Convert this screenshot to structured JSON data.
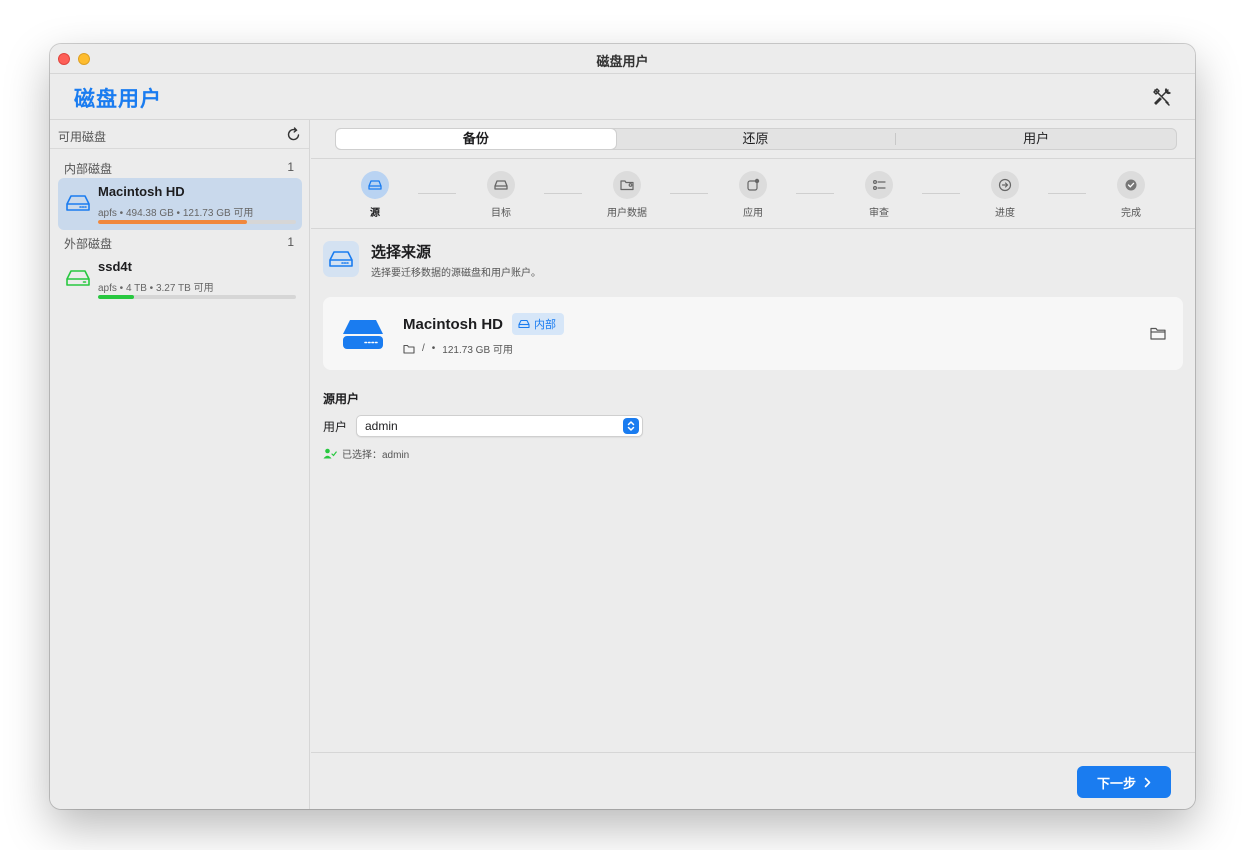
{
  "window": {
    "title": "磁盘用户"
  },
  "header": {
    "app_title": "磁盘用户",
    "tools_icon": "wrench-screwdriver-icon"
  },
  "sidebar": {
    "heading": "可用磁盘",
    "refresh_icon": "refresh-icon",
    "groups": [
      {
        "label": "内部磁盘",
        "count": "1",
        "disks": [
          {
            "name": "Macintosh HD",
            "meta": "apfs • 494.38 GB • 121.73 GB 可用",
            "usage": 0.75,
            "bar_color": "#f0883e",
            "icon_color": "#1a7cf0",
            "selected": true
          }
        ]
      },
      {
        "label": "外部磁盘",
        "count": "1",
        "disks": [
          {
            "name": "ssd4t",
            "meta": "apfs • 4 TB • 3.27 TB 可用",
            "usage": 0.18,
            "bar_color": "#28c840",
            "icon_color": "#28c840",
            "selected": false
          }
        ]
      }
    ]
  },
  "tabs": [
    {
      "label": "备份",
      "active": true
    },
    {
      "label": "还原",
      "active": false
    },
    {
      "label": "用户",
      "active": false
    }
  ],
  "steps": [
    {
      "label": "源",
      "icon": "drive-icon",
      "active": true
    },
    {
      "label": "目标",
      "icon": "drive-icon",
      "active": false
    },
    {
      "label": "用户数据",
      "icon": "folder-person-icon",
      "active": false
    },
    {
      "label": "应用",
      "icon": "app-badge-icon",
      "active": false
    },
    {
      "label": "审查",
      "icon": "checklist-icon",
      "active": false
    },
    {
      "label": "进度",
      "icon": "arrow-circle-icon",
      "active": false
    },
    {
      "label": "完成",
      "icon": "checkmark-circle-icon",
      "active": false
    }
  ],
  "source": {
    "title": "选择来源",
    "subtitle": "选择要迁移数据的源磁盘和用户账户。",
    "disk": {
      "name": "Macintosh HD",
      "badge": "内部",
      "path": "/",
      "free": "121.73 GB 可用"
    }
  },
  "users": {
    "title": "源用户",
    "label": "用户",
    "selected_value": "admin",
    "selected_note": "已选择：admin"
  },
  "footer": {
    "next_label": "下一步"
  },
  "colors": {
    "accent": "#1a7cf0",
    "warning": "#f0883e",
    "success": "#28c840"
  }
}
